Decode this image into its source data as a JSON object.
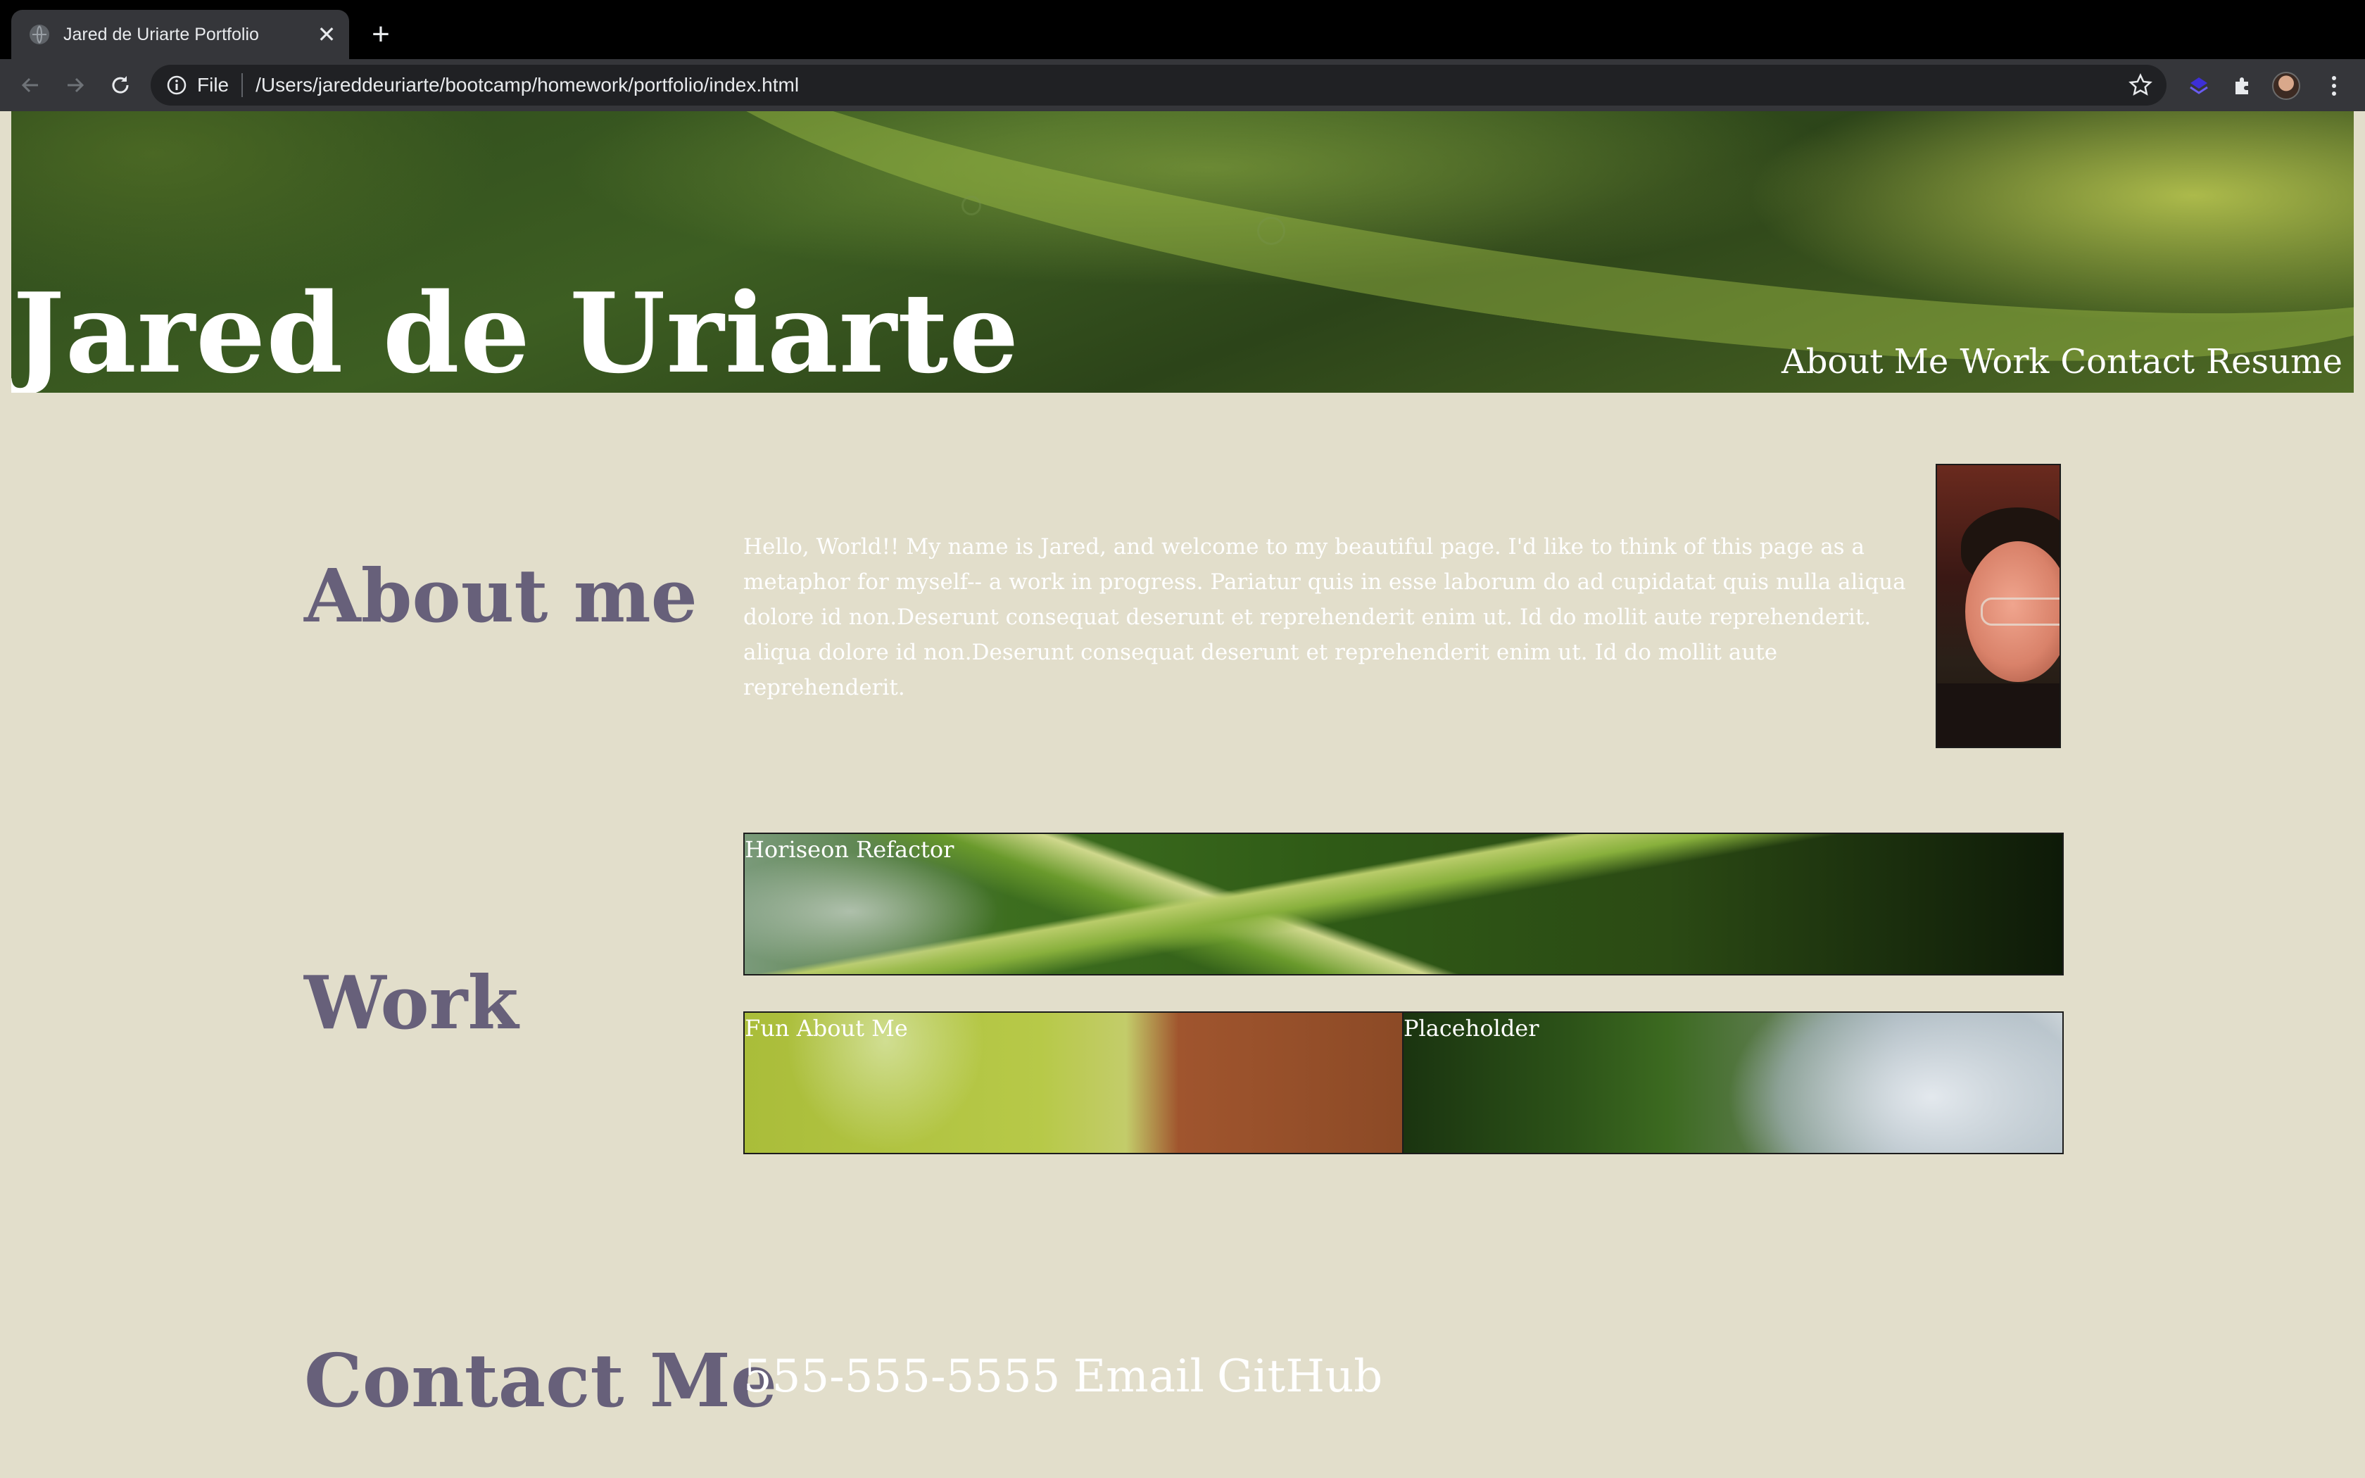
{
  "browser": {
    "tab_title": "Jared de Uriarte Portfolio",
    "close_glyph": "✕",
    "new_tab_glyph": "+",
    "url_scheme": "File",
    "url": "/Users/jareddeuriarte/bootcamp/homework/portfolio/index.html"
  },
  "header": {
    "name": "Jared de Uriarte",
    "nav": [
      "About Me",
      "Work",
      "Contact",
      "Resume"
    ]
  },
  "about": {
    "heading": "About me",
    "text": "Hello, World!! My name is Jared, and welcome to my beautiful page. I'd like to think of this page as a metaphor for myself-- a work in progress. Pariatur quis in esse laborum do ad cupidatat quis nulla aliqua dolore id non.Deserunt consequat deserunt et reprehenderit enim ut. Id do mollit aute reprehenderit. aliqua dolore id non.Deserunt consequat deserunt et reprehenderit enim ut. Id do mollit aute reprehenderit."
  },
  "work": {
    "heading": "Work",
    "projects": [
      "Horiseon Refactor",
      "Fun About Me",
      "Placeholder"
    ]
  },
  "contact": {
    "heading": "Contact Me",
    "links": [
      "555-555-5555",
      "Email",
      "GitHub"
    ]
  },
  "colors": {
    "page_background": "#e2decb",
    "heading_color": "#67607a",
    "text_color": "#ffffff"
  }
}
